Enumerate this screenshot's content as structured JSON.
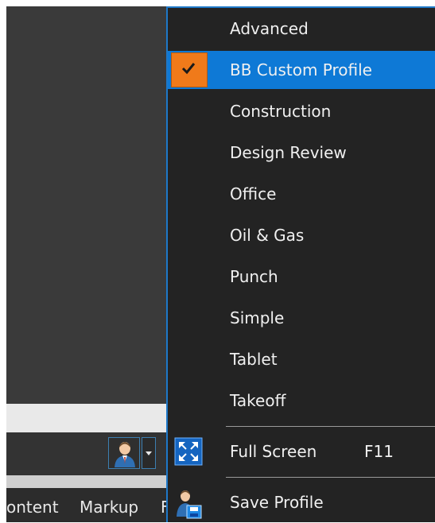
{
  "app": {
    "ribbon_tabs": [
      "ontent",
      "Markup",
      "F"
    ]
  },
  "status_bar": {
    "profile_icon": "user-profile-icon",
    "dropdown_icon": "chevron-down-icon"
  },
  "profile_menu": {
    "accent_color": "#0e79d6",
    "check_color": "#f07a1a",
    "profiles": [
      {
        "label": "Advanced",
        "checked": false
      },
      {
        "label": "BB Custom Profile",
        "checked": true
      },
      {
        "label": "Construction",
        "checked": false
      },
      {
        "label": "Design Review",
        "checked": false
      },
      {
        "label": "Office",
        "checked": false
      },
      {
        "label": "Oil & Gas",
        "checked": false
      },
      {
        "label": "Punch",
        "checked": false
      },
      {
        "label": "Simple",
        "checked": false
      },
      {
        "label": "Tablet",
        "checked": false
      },
      {
        "label": "Takeoff",
        "checked": false
      }
    ],
    "actions": {
      "full_screen": {
        "label": "Full Screen",
        "shortcut": "F11",
        "icon": "fullscreen-icon"
      },
      "save_profile": {
        "label": "Save Profile",
        "icon": "save-profile-icon"
      }
    }
  }
}
